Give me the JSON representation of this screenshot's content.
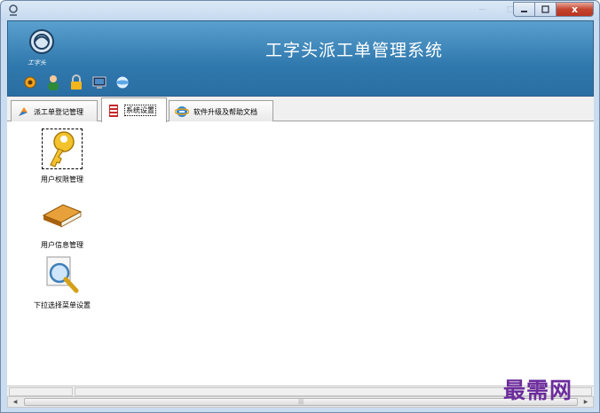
{
  "window": {
    "system_title": "工字头派工单管理系统",
    "logo_text": "工字头",
    "close_glyph": "x"
  },
  "toolbar": {
    "icons": [
      "gear-icon",
      "user-icon",
      "lock-icon",
      "monitor-icon",
      "globe-icon"
    ]
  },
  "tabs": [
    {
      "label": "派工单登记管理",
      "icon": "arrow-icon",
      "active": false
    },
    {
      "label": "系统设置",
      "icon": "film-icon",
      "active": true
    },
    {
      "label": "软件升级及帮助文档",
      "icon": "ie-icon",
      "active": false
    }
  ],
  "launchers": [
    {
      "label": "用户权限管理",
      "icon": "key-icon",
      "selected": true
    },
    {
      "label": "用户信息管理",
      "icon": "book-icon",
      "selected": false
    },
    {
      "label": "下拉选择菜单设置",
      "icon": "magnifier-icon",
      "selected": false
    }
  ],
  "scroll": {
    "grip": "|||"
  },
  "watermark": "最需网",
  "colors": {
    "banner": "#2f78ad",
    "accent": "#6c2c9c"
  }
}
